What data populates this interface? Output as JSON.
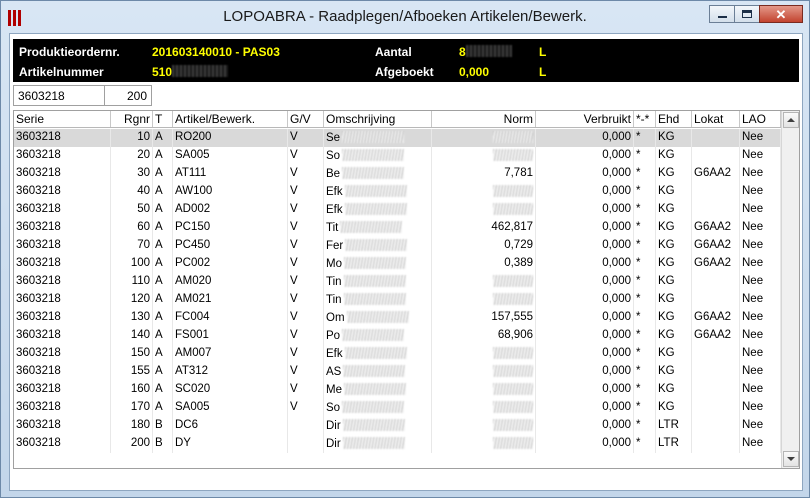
{
  "window": {
    "title": "LOPOABRA - Raadplegen/Afboeken Artikelen/Bewerk.",
    "icon": "app-bars-icon",
    "accent_color": "#b00000"
  },
  "header": {
    "prod_label": "Produktieordernr.",
    "prod_value": "201603140010 - PAS03",
    "artikel_label": "Artikelnummer",
    "artikel_value": "510",
    "aantal_label": "Aantal",
    "aantal_value": "8",
    "aantal_unit": "L",
    "afgeboekt_label": "Afgeboekt",
    "afgeboekt_value": "0,000",
    "afgeboekt_unit": "L"
  },
  "filter": {
    "serie": "3603218",
    "rgnr": "200"
  },
  "grid": {
    "columns": [
      "Serie",
      "Rgnr",
      "T",
      "Artikel/Bewerk.",
      "G/V",
      "Omschrijving",
      "Norm",
      "Verbruikt",
      "*-*",
      "Ehd",
      "Lokat",
      "LAO"
    ],
    "rows": [
      {
        "serie": "3603218",
        "rgnr": "10",
        "t": "A",
        "art": "RO200",
        "gv": "V",
        "oms": "Se",
        "norm": "",
        "verb": "0,000",
        "ster": "*",
        "ehd": "KG",
        "lok": "",
        "lao": "Nee"
      },
      {
        "serie": "3603218",
        "rgnr": "20",
        "t": "A",
        "art": "SA005",
        "gv": "V",
        "oms": "So",
        "norm": "",
        "verb": "0,000",
        "ster": "*",
        "ehd": "KG",
        "lok": "",
        "lao": "Nee"
      },
      {
        "serie": "3603218",
        "rgnr": "30",
        "t": "A",
        "art": "AT111",
        "gv": "V",
        "oms": "Be",
        "norm": "7,781",
        "verb": "0,000",
        "ster": "*",
        "ehd": "KG",
        "lok": "G6AA2",
        "lao": "Nee"
      },
      {
        "serie": "3603218",
        "rgnr": "40",
        "t": "A",
        "art": "AW100",
        "gv": "V",
        "oms": "Efk",
        "norm": "",
        "verb": "0,000",
        "ster": "*",
        "ehd": "KG",
        "lok": "",
        "lao": "Nee"
      },
      {
        "serie": "3603218",
        "rgnr": "50",
        "t": "A",
        "art": "AD002",
        "gv": "V",
        "oms": "Efk",
        "norm": "",
        "verb": "0,000",
        "ster": "*",
        "ehd": "KG",
        "lok": "",
        "lao": "Nee"
      },
      {
        "serie": "3603218",
        "rgnr": "60",
        "t": "A",
        "art": "PC150",
        "gv": "V",
        "oms": "Tit",
        "norm": "462,817",
        "verb": "0,000",
        "ster": "*",
        "ehd": "KG",
        "lok": "G6AA2",
        "lao": "Nee"
      },
      {
        "serie": "3603218",
        "rgnr": "70",
        "t": "A",
        "art": "PC450",
        "gv": "V",
        "oms": "Fer",
        "norm": "0,729",
        "verb": "0,000",
        "ster": "*",
        "ehd": "KG",
        "lok": "G6AA2",
        "lao": "Nee"
      },
      {
        "serie": "3603218",
        "rgnr": "100",
        "t": "A",
        "art": "PC002",
        "gv": "V",
        "oms": "Mo",
        "norm": "0,389",
        "verb": "0,000",
        "ster": "*",
        "ehd": "KG",
        "lok": "G6AA2",
        "lao": "Nee"
      },
      {
        "serie": "3603218",
        "rgnr": "110",
        "t": "A",
        "art": "AM020",
        "gv": "V",
        "oms": "Tin",
        "norm": "",
        "verb": "0,000",
        "ster": "*",
        "ehd": "KG",
        "lok": "",
        "lao": "Nee"
      },
      {
        "serie": "3603218",
        "rgnr": "120",
        "t": "A",
        "art": "AM021",
        "gv": "V",
        "oms": "Tin",
        "norm": "",
        "verb": "0,000",
        "ster": "*",
        "ehd": "KG",
        "lok": "",
        "lao": "Nee"
      },
      {
        "serie": "3603218",
        "rgnr": "130",
        "t": "A",
        "art": "FC004",
        "gv": "V",
        "oms": "Om",
        "norm": "157,555",
        "verb": "0,000",
        "ster": "*",
        "ehd": "KG",
        "lok": "G6AA2",
        "lao": "Nee"
      },
      {
        "serie": "3603218",
        "rgnr": "140",
        "t": "A",
        "art": "FS001",
        "gv": "V",
        "oms": "Po",
        "norm": "68,906",
        "verb": "0,000",
        "ster": "*",
        "ehd": "KG",
        "lok": "G6AA2",
        "lao": "Nee"
      },
      {
        "serie": "3603218",
        "rgnr": "150",
        "t": "A",
        "art": "AM007",
        "gv": "V",
        "oms": "Efk",
        "norm": "",
        "verb": "0,000",
        "ster": "*",
        "ehd": "KG",
        "lok": "",
        "lao": "Nee"
      },
      {
        "serie": "3603218",
        "rgnr": "155",
        "t": "A",
        "art": "AT312",
        "gv": "V",
        "oms": "AS",
        "norm": "",
        "verb": "0,000",
        "ster": "*",
        "ehd": "KG",
        "lok": "",
        "lao": "Nee"
      },
      {
        "serie": "3603218",
        "rgnr": "160",
        "t": "A",
        "art": "SC020",
        "gv": "V",
        "oms": "Me",
        "norm": "",
        "verb": "0,000",
        "ster": "*",
        "ehd": "KG",
        "lok": "",
        "lao": "Nee"
      },
      {
        "serie": "3603218",
        "rgnr": "170",
        "t": "A",
        "art": "SA005",
        "gv": "V",
        "oms": "So",
        "norm": "",
        "verb": "0,000",
        "ster": "*",
        "ehd": "KG",
        "lok": "",
        "lao": "Nee"
      },
      {
        "serie": "3603218",
        "rgnr": "180",
        "t": "B",
        "art": "DC6",
        "gv": "",
        "oms": "Dir",
        "norm": "",
        "verb": "0,000",
        "ster": "*",
        "ehd": "LTR",
        "lok": "",
        "lao": "Nee"
      },
      {
        "serie": "3603218",
        "rgnr": "200",
        "t": "B",
        "art": "DY",
        "gv": "",
        "oms": "Dir",
        "norm": "",
        "verb": "0,000",
        "ster": "*",
        "ehd": "LTR",
        "lok": "",
        "lao": "Nee"
      }
    ]
  }
}
